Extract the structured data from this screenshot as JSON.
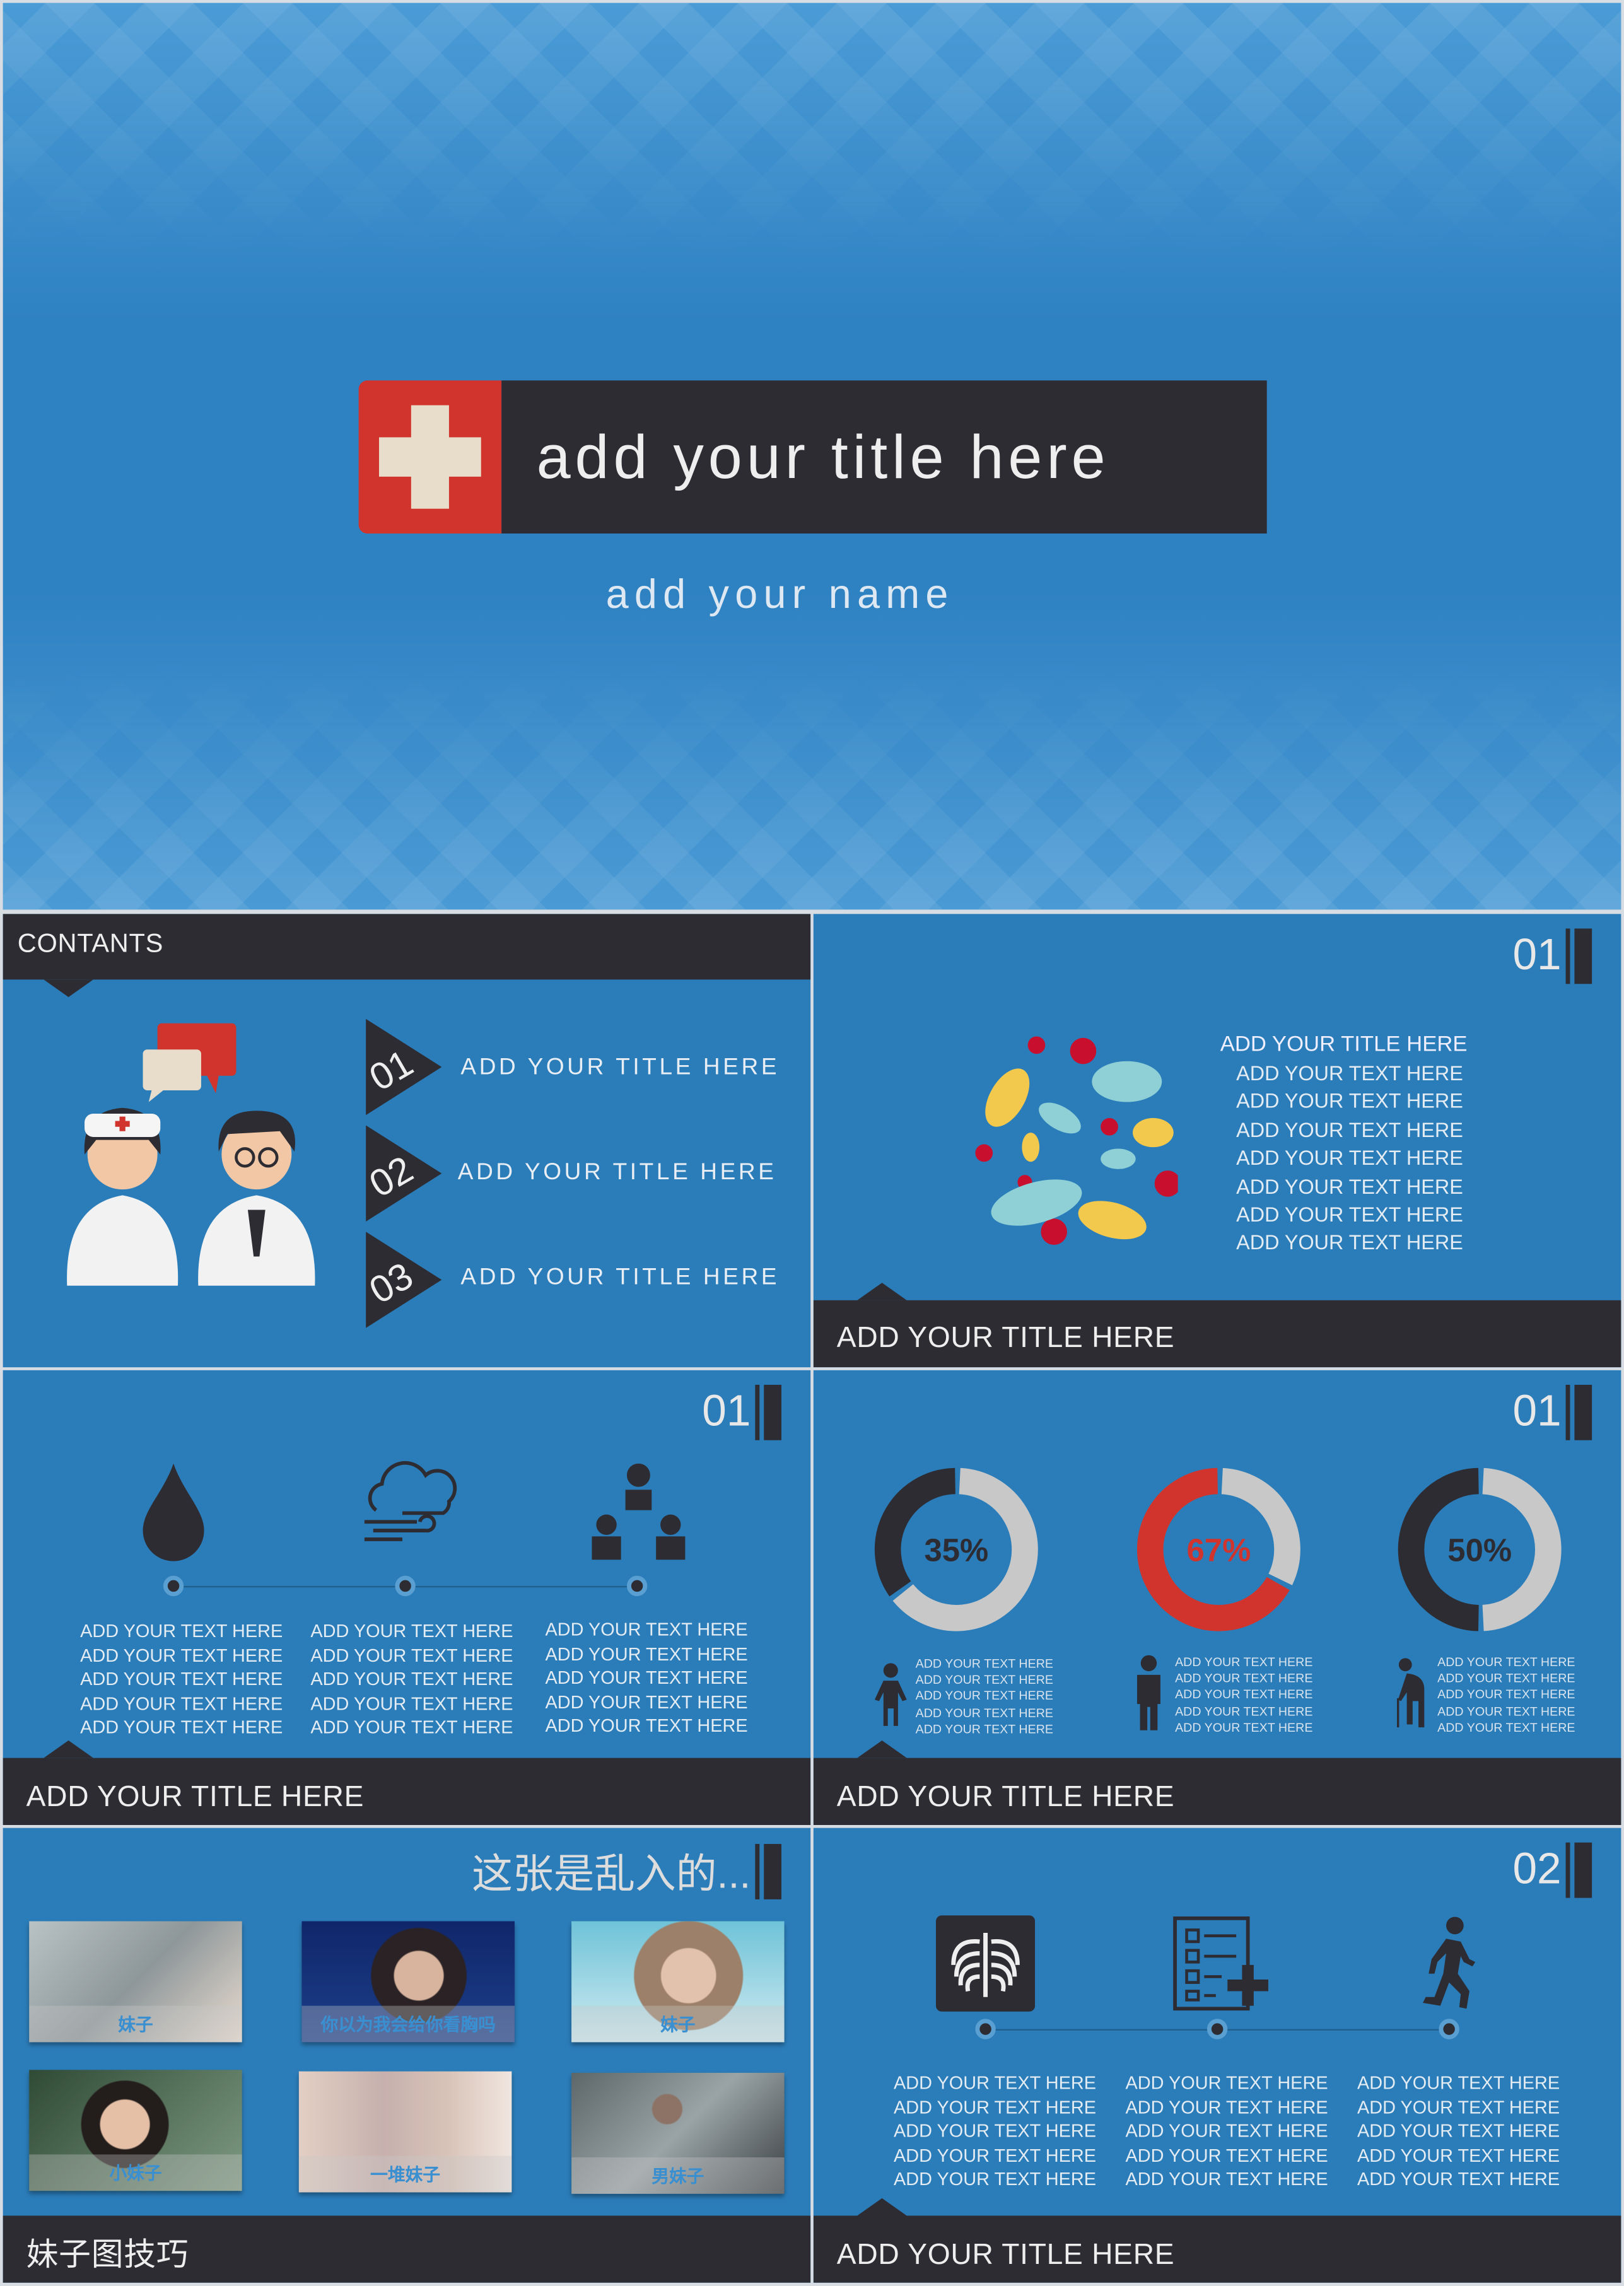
{
  "colors": {
    "blue": "#2b7dba",
    "dark": "#2d2c33",
    "red": "#d0342c",
    "gray": "#c8c8c8",
    "cream": "#e8dccb"
  },
  "cover": {
    "title": "add your title here",
    "name": "add your name",
    "icon": "medical-cross-icon"
  },
  "contents": {
    "header": "CONTANTS",
    "items": [
      {
        "num": "01",
        "label": "ADD YOUR TITLE HERE"
      },
      {
        "num": "02",
        "label": "ADD YOUR TITLE HERE"
      },
      {
        "num": "03",
        "label": "ADD YOUR TITLE HERE"
      }
    ]
  },
  "germs": {
    "number": "01",
    "heading": "ADD YOUR TITLE HERE",
    "lines": [
      "ADD YOUR TEXT HERE",
      "ADD YOUR TEXT HERE",
      "ADD YOUR TEXT HERE",
      "ADD YOUR TEXT HERE",
      "ADD YOUR TEXT HERE",
      "ADD YOUR TEXT HERE",
      "ADD YOUR TEXT HERE"
    ],
    "footer": "ADD YOUR TITLE HERE"
  },
  "timeline1": {
    "number": "01",
    "icons": [
      "water-drop-icon",
      "cloud-wind-icon",
      "people-group-icon"
    ],
    "columns": [
      [
        "ADD YOUR TEXT HERE",
        "ADD YOUR TEXT HERE",
        "ADD YOUR TEXT HERE",
        "ADD YOUR TEXT HERE",
        "ADD YOUR TEXT HERE"
      ],
      [
        "ADD YOUR TEXT HERE",
        "ADD YOUR TEXT HERE",
        "ADD YOUR TEXT HERE",
        "ADD YOUR TEXT HERE",
        "ADD YOUR TEXT HERE"
      ],
      [
        "ADD YOUR TEXT HERE",
        "ADD YOUR TEXT HERE",
        "ADD YOUR TEXT HERE",
        "ADD YOUR TEXT HERE",
        "ADD YOUR TEXT HERE"
      ]
    ],
    "footer": "ADD YOUR TITLE HERE"
  },
  "donuts": {
    "number": "01",
    "items": [
      {
        "label": "35%",
        "value": 35,
        "color": "#2d2c33",
        "icon": "child-icon"
      },
      {
        "label": "67%",
        "value": 67,
        "color": "#d0342c",
        "icon": "man-icon"
      },
      {
        "label": "50%",
        "value": 50,
        "color": "#2d2c33",
        "icon": "elderly-cane-icon"
      }
    ],
    "lines": [
      "ADD YOUR TEXT HERE",
      "ADD YOUR TEXT HERE",
      "ADD YOUR TEXT HERE",
      "ADD YOUR TEXT HERE",
      "ADD YOUR TEXT HERE"
    ],
    "footer": "ADD YOUR TITLE HERE"
  },
  "photos": {
    "title": "这张是乱入的...",
    "captions": [
      "妹子",
      "你以为我会给你看胸吗",
      "妹子",
      "小妹子",
      "一堆妹子",
      "男妹子"
    ],
    "footer": "妹子图技巧"
  },
  "timeline2": {
    "number": "02",
    "icons": [
      "xray-ribcage-icon",
      "checklist-plus-icon",
      "walking-person-icon"
    ],
    "columns": [
      [
        "ADD YOUR TEXT HERE",
        "ADD YOUR TEXT HERE",
        "ADD YOUR TEXT HERE",
        "ADD YOUR TEXT HERE",
        "ADD YOUR TEXT HERE"
      ],
      [
        "ADD YOUR TEXT HERE",
        "ADD YOUR TEXT HERE",
        "ADD YOUR TEXT HERE",
        "ADD YOUR TEXT HERE",
        "ADD YOUR TEXT HERE"
      ],
      [
        "ADD YOUR TEXT HERE",
        "ADD YOUR TEXT HERE",
        "ADD YOUR TEXT HERE",
        "ADD YOUR TEXT HERE",
        "ADD YOUR TEXT HERE"
      ]
    ],
    "footer": "ADD YOUR TITLE HERE"
  }
}
